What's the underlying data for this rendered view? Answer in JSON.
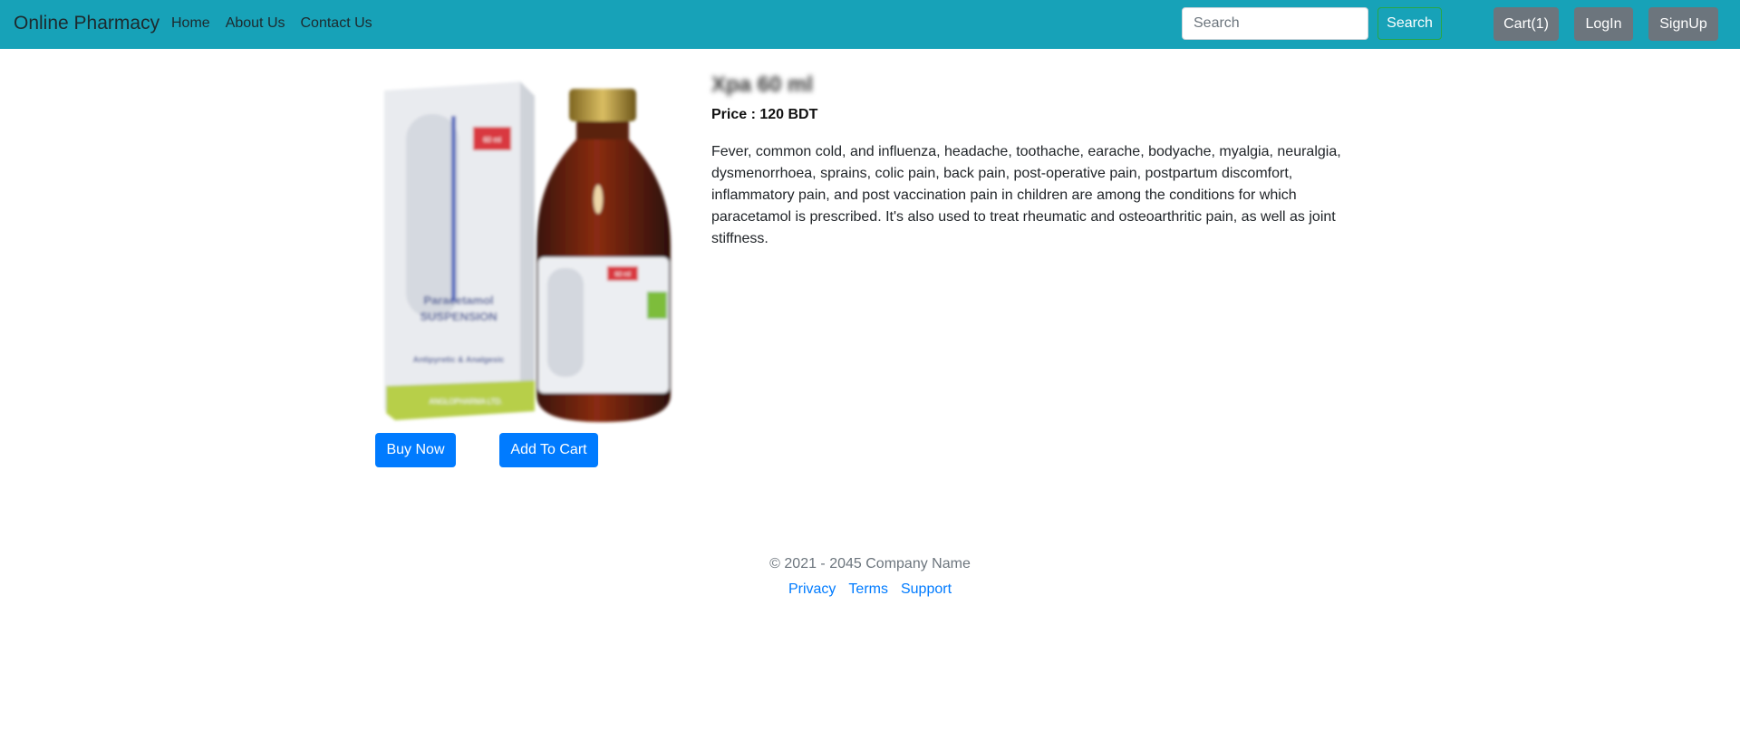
{
  "navbar": {
    "brand": "Online Pharmacy",
    "links": [
      "Home",
      "About Us",
      "Contact Us"
    ],
    "search_placeholder": "Search",
    "search_button": "Search",
    "cart_button": "Cart(1)",
    "login_button": "LogIn",
    "signup_button": "SignUp"
  },
  "product": {
    "title": "Xpa 60 ml",
    "price_label": "Price : 120 BDT",
    "description": "Fever, common cold, and influenza, headache, toothache, earache, bodyache, myalgia, neuralgia, dysmenorrhoea, sprains, colic pain, back pain, post-operative pain, postpartum discomfort, inflammatory pain, and post vaccination pain in children are among the conditions for which paracetamol is prescribed. It's also used to treat rheumatic and osteoarthritic pain, as well as joint stiffness.",
    "image_text": {
      "box_label": "60 ml",
      "box_name_line1": "Paracetamol",
      "box_name_line2": "SUSPENSION",
      "box_subtitle": "Antipyretic & Analgesic",
      "box_maker": "ANGLOPHARMA LTD.",
      "bottle_label": "60 ml"
    },
    "buy_button": "Buy Now",
    "add_cart_button": "Add To Cart"
  },
  "footer": {
    "copyright": "© 2021 - 2045 Company Name",
    "links": [
      "Privacy",
      "Terms",
      "Support"
    ]
  },
  "colors": {
    "navbar": "#17a2b8",
    "primary": "#007bff",
    "secondary": "#6c757d",
    "success_outline": "#28a745"
  }
}
